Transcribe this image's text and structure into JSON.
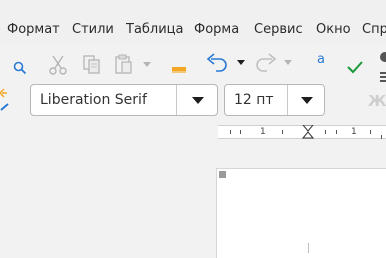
{
  "menu": {
    "items": [
      {
        "label": "Формат"
      },
      {
        "label": "Стили"
      },
      {
        "label": "Таблица"
      },
      {
        "label": "Форма"
      },
      {
        "label": "Сервис"
      },
      {
        "label": "Окно"
      },
      {
        "label": "Спр"
      }
    ]
  },
  "toolbar": {
    "autocorrect_glyph": "a",
    "icons": [
      "search-icon",
      "cut-icon",
      "copy-icon",
      "paste-icon",
      "highlighter-icon",
      "undo-icon",
      "redo-icon",
      "autocorrect-icon",
      "checkmark-icon"
    ]
  },
  "format": {
    "font_name": "Liberation Serif",
    "font_size": "12 пт",
    "faded_glyph": "Ж"
  },
  "ruler": {
    "labels": [
      "1",
      "1"
    ]
  },
  "colors": {
    "accent_blue": "#2a7ad5",
    "check_green": "#1c9b3a",
    "highlight_orange": "#f5a623"
  }
}
